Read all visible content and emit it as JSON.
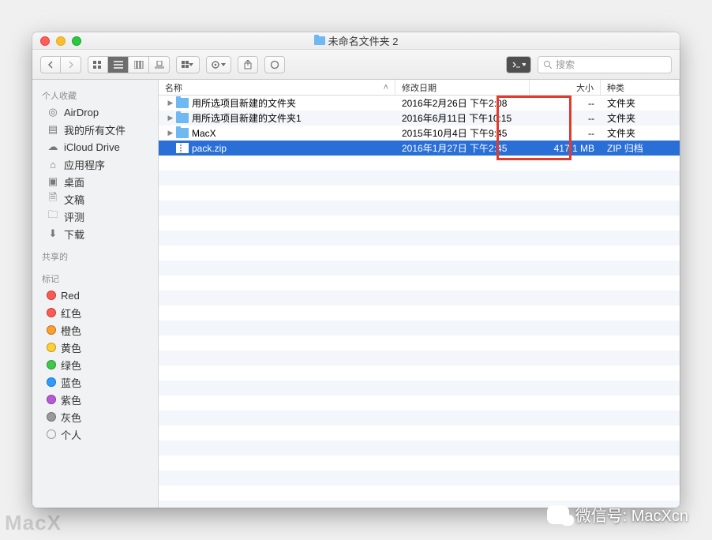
{
  "window": {
    "title": "未命名文件夹 2"
  },
  "search": {
    "placeholder": "搜索"
  },
  "columns": {
    "name": "名称",
    "date": "修改日期",
    "size": "大小",
    "kind": "种类"
  },
  "sidebar": {
    "favorites_heading": "个人收藏",
    "favorites": [
      {
        "icon": "◎",
        "label": "AirDrop"
      },
      {
        "icon": "▤",
        "label": "我的所有文件"
      },
      {
        "icon": "☁",
        "label": "iCloud Drive"
      },
      {
        "icon": "⌂",
        "label": "应用程序"
      },
      {
        "icon": "▣",
        "label": "桌面"
      },
      {
        "icon": "🗎",
        "label": "文稿"
      },
      {
        "icon": "🗀",
        "label": "评测"
      },
      {
        "icon": "⬇",
        "label": "下载"
      }
    ],
    "shared_heading": "共享的",
    "tags_heading": "标记",
    "tags": [
      {
        "color": "#ff5a52",
        "label": "Red"
      },
      {
        "color": "#ff5a52",
        "label": "红色"
      },
      {
        "color": "#ff9d2f",
        "label": "橙色"
      },
      {
        "color": "#ffd02f",
        "label": "黄色"
      },
      {
        "color": "#3ec94b",
        "label": "绿色"
      },
      {
        "color": "#2d9cff",
        "label": "蓝色"
      },
      {
        "color": "#b759d6",
        "label": "紫色"
      },
      {
        "color": "#9a9a9a",
        "label": "灰色"
      },
      {
        "color": "transparent",
        "label": "个人"
      }
    ]
  },
  "files": [
    {
      "expandable": true,
      "icon": "folder",
      "name": "用所选项目新建的文件夹",
      "date": "2016年2月26日 下午2:08",
      "size": "--",
      "kind": "文件夹",
      "selected": false
    },
    {
      "expandable": true,
      "icon": "folder",
      "name": "用所选项目新建的文件夹1",
      "date": "2016年6月11日 下午10:15",
      "size": "--",
      "kind": "文件夹",
      "selected": false
    },
    {
      "expandable": true,
      "icon": "folder",
      "name": "MacX",
      "date": "2015年10月4日 下午9:45",
      "size": "--",
      "kind": "文件夹",
      "selected": false
    },
    {
      "expandable": false,
      "icon": "zip",
      "name": "pack.zip",
      "date": "2016年1月27日 下午2:45",
      "size": "417.1 MB",
      "kind": "ZIP 归档",
      "selected": true
    }
  ],
  "watermark": {
    "bl": "MacX",
    "br": "微信号: MacXcn"
  }
}
